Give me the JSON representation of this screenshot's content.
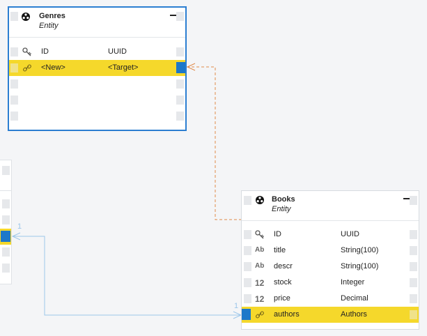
{
  "colors": {
    "selection": "#2b7ed1",
    "highlight": "#f5d82b",
    "port": "#1d78c9",
    "dashed_link": "#e08a4a",
    "solid_link": "#9cc6ea"
  },
  "genres": {
    "title": "Genres",
    "subtitle": "Entity",
    "rows": [
      {
        "icon": "key-icon",
        "name": "ID",
        "type": "UUID"
      },
      {
        "icon": "link-icon",
        "name": "<New>",
        "type": "<Target>"
      }
    ]
  },
  "books": {
    "title": "Books",
    "subtitle": "Entity",
    "rows": [
      {
        "icon": "key-icon",
        "icon_text": "",
        "name": "ID",
        "type": "UUID"
      },
      {
        "icon": "text-type-icon",
        "icon_text": "Ab",
        "name": "title",
        "type": "String(100)"
      },
      {
        "icon": "text-type-icon",
        "icon_text": "Ab",
        "name": "descr",
        "type": "String(100)"
      },
      {
        "icon": "number-type-icon",
        "icon_text": "12",
        "name": "stock",
        "type": "Integer"
      },
      {
        "icon": "number-type-icon",
        "icon_text": "12",
        "name": "price",
        "type": "Decimal"
      },
      {
        "icon": "link-icon",
        "icon_text": "",
        "name": "authors",
        "type": "Authors"
      }
    ]
  },
  "links": {
    "left_cardinality": "1",
    "right_cardinality": "1"
  }
}
